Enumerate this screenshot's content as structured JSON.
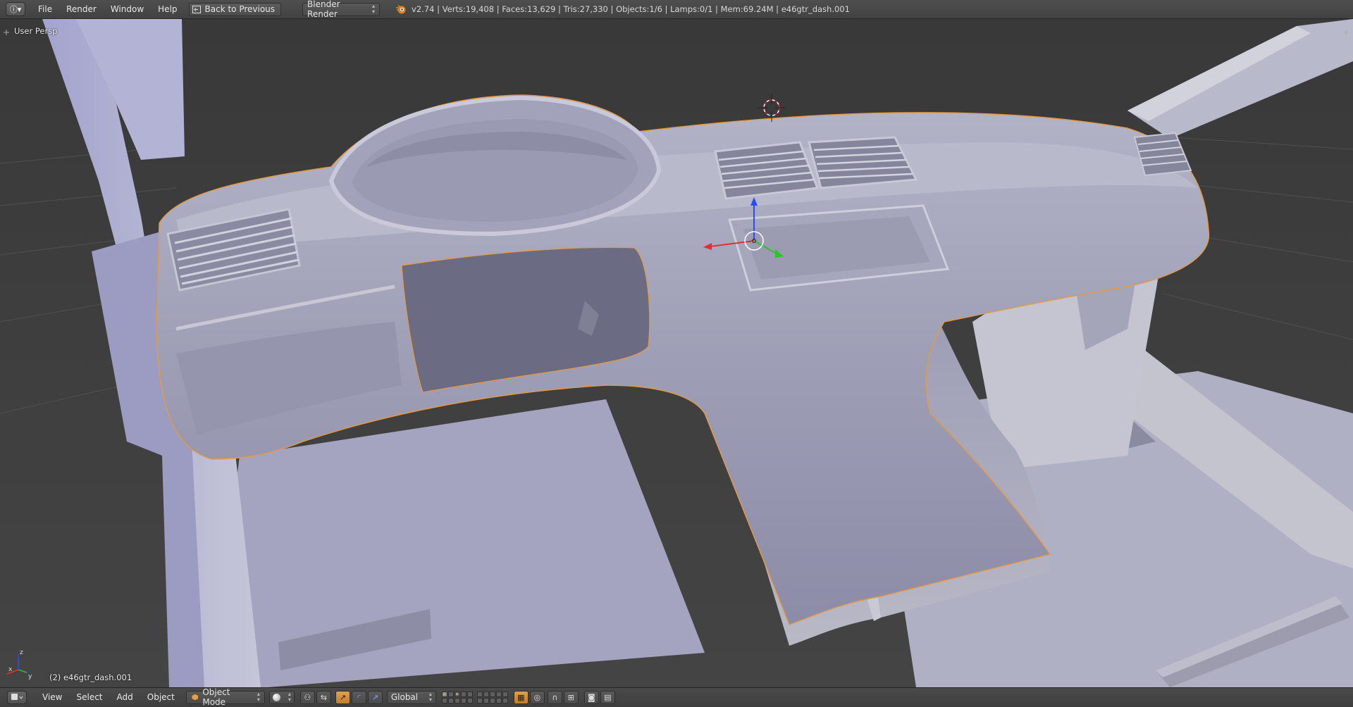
{
  "topbar": {
    "editor_icon": "info-icon",
    "menus": [
      "File",
      "Render",
      "Window",
      "Help"
    ],
    "back_button": "Back to Previous",
    "render_engine": "Blender Render",
    "stats": "v2.74 | Verts:19,408 | Faces:13,629 | Tris:27,330 | Objects:1/6 | Lamps:0/1 | Mem:69.24M | e46gtr_dash.001"
  },
  "viewport": {
    "view_name": "User Persp",
    "object_label": "(2) e46gtr_dash.001",
    "axis_labels": {
      "x": "x",
      "y": "y",
      "z": "z"
    }
  },
  "bottombar": {
    "menus": [
      "View",
      "Select",
      "Add",
      "Object"
    ],
    "mode": "Object Mode",
    "orientation": "Global"
  },
  "colors": {
    "header": "#444444",
    "viewport_bg": "#3d3d3d",
    "mesh": "#a9a9c6",
    "selection_outline": "#e59a3d",
    "axis_x": "#e03030",
    "axis_y": "#30c030",
    "axis_z": "#2a4cff"
  }
}
